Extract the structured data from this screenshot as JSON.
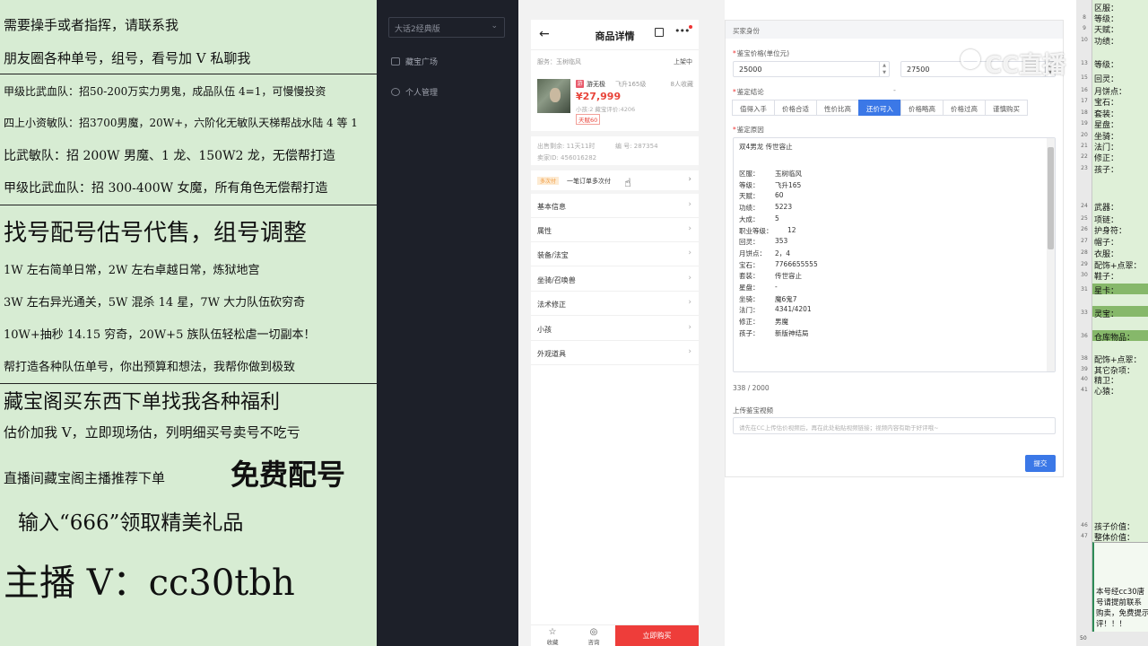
{
  "left_panel": {
    "lines": [
      "需要操手或者指挥，请联系我",
      "朋友圈各种单号，组号，看号加 V 私聊我",
      "甲级比武血队：招50-200万实力男鬼，成品队伍 4=1，可慢慢投资",
      "四上小资敏队：招3700男魔，20W+，六阶化无敏队天梯帮战水陆 4 等 1",
      "比武敏队：招 200W 男魔、1 龙、150W2 龙，无偿帮打造",
      "甲级比武血队：招 300-400W 女魔，所有角色无偿帮打造",
      "找号配号估号代售，组号调整",
      "1W 左右简单日常，2W 左右卓越日常，炼狱地宫",
      "3W 左右异光通关，5W 混杀 14 星，7W 大力队伍砍穷奇",
      "10W+抽秒 14.15 穷奇，20W+5 族队伍轻松虐一切副本！",
      "帮打造各种队伍单号，你出预算和想法，我帮你做到极致",
      "藏宝阁买东西下单找我各种福利",
      "估价加我 V，立即现场估，列明细买号卖号不吃亏",
      "直播间藏宝阁主播推荐下单",
      "免费配号",
      "输入“666”领取精美礼品",
      "主播 V：cc30tbh"
    ]
  },
  "sidebar": {
    "game_select": "大话2经典版",
    "items": [
      "藏宝广场",
      "个人管理"
    ]
  },
  "phone": {
    "title": "商品详情",
    "server": "服务：玉树临风",
    "status": "上架中",
    "item_badge": "游",
    "item_name": "游无极",
    "item_level": "飞升165级",
    "fav_count": "8人收藏",
    "price": "¥27,999",
    "sub_info": "小孩:2 藏宝评价:4206",
    "tag": "天赋60",
    "meta_time": "出售剩余: 11天11时",
    "meta_no": "编 号: 287354",
    "meta_id": "卖家ID: 456016282",
    "pay_tag": "多次付",
    "pay_text": "一笔订单多次付",
    "menu": [
      "基本信息",
      "属性",
      "装备/法宝",
      "坐骑/召唤兽",
      "法术修正",
      "小孩",
      "外观道具"
    ],
    "bottom": {
      "fav": "收藏",
      "consult": "咨询",
      "buy": "立即购买"
    }
  },
  "form": {
    "section": "买家身份",
    "price_label": "鉴宝价格(单位元)",
    "price_min": "25000",
    "price_max": "27500",
    "verdict_label": "鉴定结论",
    "verdicts": [
      "值得入手",
      "价格合适",
      "性价比高",
      "还价可入",
      "价格略高",
      "价格过高",
      "谨慎购买"
    ],
    "reason_label": "鉴定原因",
    "reason_title": "双4男龙 传世容止",
    "reason_rows": [
      {
        "k": "区服：",
        "v": "玉树临风"
      },
      {
        "k": "等级：",
        "v": "飞升165"
      },
      {
        "k": "天赋：",
        "v": "60"
      },
      {
        "k": "功绩：",
        "v": "5223"
      },
      {
        "k": "大成：",
        "v": "5"
      },
      {
        "k": "职业等级：",
        "v": "12"
      },
      {
        "k": "回灵：",
        "v": "353"
      },
      {
        "k": "月饼点：",
        "v": "2，4"
      },
      {
        "k": "宝石：",
        "v": "7766655555"
      },
      {
        "k": "套装：",
        "v": "传世容止"
      },
      {
        "k": "星盘：",
        "v": "-"
      },
      {
        "k": "坐骑：",
        "v": "魔6鬼7"
      },
      {
        "k": "法门：",
        "v": "4341/4201"
      },
      {
        "k": "修正：",
        "v": "男魔"
      },
      {
        "k": "孩子：",
        "v": "新版神结局"
      }
    ],
    "char_count": "338 / 2000",
    "video_label": "上传鉴宝视频",
    "video_placeholder": "请先在CC上传估价视频后，再在此处粘贴视频链接；视频内容有助于好评哦~",
    "submit": "提交"
  },
  "watermark": "CC直播",
  "sheet": {
    "rows": [
      {
        "n": "",
        "t": "区服："
      },
      {
        "n": "8",
        "t": "等级："
      },
      {
        "n": "9",
        "t": "天赋："
      },
      {
        "n": "10",
        "t": "功绩："
      },
      {
        "n": "13",
        "t": "等级："
      },
      {
        "n": "15",
        "t": "回灵："
      },
      {
        "n": "16",
        "t": "月饼点："
      },
      {
        "n": "17",
        "t": "宝石："
      },
      {
        "n": "18",
        "t": "套装："
      },
      {
        "n": "19",
        "t": "星盘："
      },
      {
        "n": "20",
        "t": "坐骑："
      },
      {
        "n": "21",
        "t": "法门："
      },
      {
        "n": "22",
        "t": "修正："
      },
      {
        "n": "23",
        "t": "孩子："
      },
      {
        "n": "24",
        "t": "武器："
      },
      {
        "n": "25",
        "t": "项链："
      },
      {
        "n": "26",
        "t": "护身符："
      },
      {
        "n": "27",
        "t": "帽子："
      },
      {
        "n": "28",
        "t": "衣服："
      },
      {
        "n": "29",
        "t": "配饰+点翠："
      },
      {
        "n": "30",
        "t": "鞋子："
      },
      {
        "n": "31",
        "t": "星卡："
      },
      {
        "n": "33",
        "t": "灵宝："
      },
      {
        "n": "36",
        "t": "仓库物品："
      },
      {
        "n": "38",
        "t": "配饰+点翠："
      },
      {
        "n": "39",
        "t": "其它杂项："
      },
      {
        "n": "40",
        "t": "精卫："
      },
      {
        "n": "41",
        "t": "心猿："
      },
      {
        "n": "46",
        "t": "孩子价值："
      },
      {
        "n": "47",
        "t": "整体价值："
      }
    ],
    "notes": [
      "本号经cc30唐",
      "号请提前联系",
      "购卖，免费提示",
      "评！！！"
    ],
    "footer": "50"
  }
}
